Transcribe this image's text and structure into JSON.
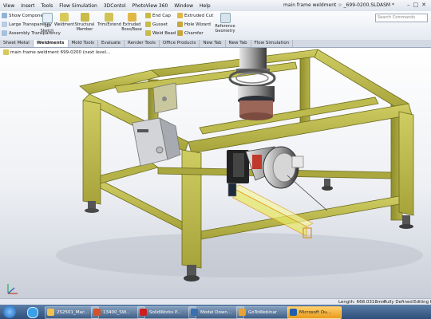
{
  "menubar": {
    "items": [
      "View",
      "Insert",
      "Tools",
      "Flow Simulation",
      "3DContol",
      "PhotoView 360",
      "Window",
      "Help"
    ],
    "title": "main frame weldment  ☆ _699-0200.SLDASM *",
    "search_placeholder": "Search Commands"
  },
  "ribbon": {
    "left_items": [
      "Show Components",
      "Large Transparency",
      "Assembly Transparency"
    ],
    "buttons": [
      "3D Sketch",
      "Weldment",
      "Structural Member",
      "Trim/Extend",
      "Extruded Boss/Base"
    ],
    "small_items": [
      "End Cap",
      "Gusset",
      "Weld Bead",
      "Extruded Cut",
      "Hole Wizard",
      "Chamfer"
    ],
    "ref_geometry": "Reference Geometry"
  },
  "tabs": [
    "Sheet Metal",
    "Weldments",
    "Mold Tools",
    "Evaluate",
    "Render Tools",
    "Office Products",
    "New Tab",
    "New Tab",
    "Flow Simulation"
  ],
  "active_tab": "Weldments",
  "tree": {
    "root": "main frame weldment  699-0200 (next level..."
  },
  "status": {
    "length": "Length: 668.0318mm",
    "state": "Fully Defined",
    "mode": "Editing Part"
  },
  "taskbar": {
    "items": [
      "2S2501_Mac...",
      "13400_SW...",
      "SolidWorks P...",
      "Model Down...",
      "GoToWebinar",
      "Microsoft Ou..."
    ]
  },
  "colors": {
    "frame": "#b7b54a",
    "frame_dark": "#7f7d24",
    "highlight": "#f3a728"
  },
  "icons": {
    "folder": "folder-icon",
    "powerpoint": "powerpoint-icon",
    "solidworks": "solidworks-icon",
    "gotowebinar": "gotowebinar-icon",
    "outlook": "outlook-icon",
    "ie": "ie-icon",
    "start": "start-orb-icon"
  }
}
